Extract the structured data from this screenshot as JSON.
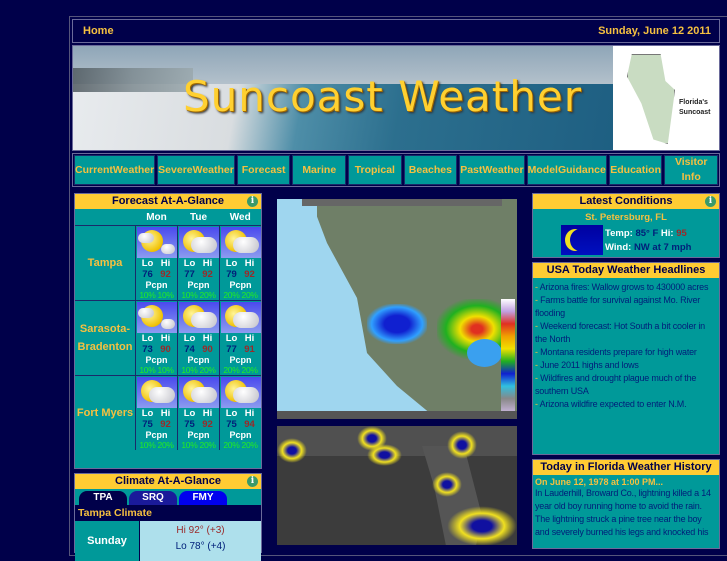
{
  "topbar": {
    "home": "Home",
    "date": "Sunday, June 12 2011"
  },
  "banner": {
    "title": "Suncoast Weather",
    "map_label_line1": "Florida's",
    "map_label_line2": "Suncoast"
  },
  "nav": [
    {
      "line1": "Current",
      "line2": "Weather"
    },
    {
      "line1": "Severe",
      "line2": "Weather"
    },
    {
      "line1": "Forecast",
      "line2": ""
    },
    {
      "line1": "Marine",
      "line2": ""
    },
    {
      "line1": "Tropical",
      "line2": ""
    },
    {
      "line1": "Beaches",
      "line2": ""
    },
    {
      "line1": "Past",
      "line2": "Weather"
    },
    {
      "line1": "Model",
      "line2": "Guidance"
    },
    {
      "line1": "Education",
      "line2": ""
    },
    {
      "line1": "Visitor Info",
      "line2": ""
    }
  ],
  "forecast": {
    "title": "Forecast At-A-Glance",
    "info_icon": "info-icon",
    "days": [
      "Mon",
      "Tue",
      "Wed"
    ],
    "labels": {
      "lo": "Lo",
      "hi": "Hi",
      "pcpn": "Pcpn"
    },
    "cities": [
      {
        "name_line1": "Tampa",
        "name_line2": "",
        "days": [
          {
            "icon": "partly-cloudy",
            "lo": "76",
            "hi": "92",
            "pcpn": "10% 10%"
          },
          {
            "icon": "mostly-cloudy",
            "lo": "77",
            "hi": "92",
            "pcpn": "10% 20%"
          },
          {
            "icon": "mostly-cloudy",
            "lo": "79",
            "hi": "92",
            "pcpn": "20% 20%"
          }
        ]
      },
      {
        "name_line1": "Sarasota-",
        "name_line2": "Bradenton",
        "days": [
          {
            "icon": "partly-cloudy",
            "lo": "73",
            "hi": "90",
            "pcpn": "10% 10%"
          },
          {
            "icon": "mostly-cloudy",
            "lo": "74",
            "hi": "90",
            "pcpn": "10% 20%"
          },
          {
            "icon": "mostly-cloudy",
            "lo": "77",
            "hi": "91",
            "pcpn": "20% 20%"
          }
        ]
      },
      {
        "name_line1": "Fort Myers",
        "name_line2": "",
        "days": [
          {
            "icon": "mostly-cloudy",
            "lo": "75",
            "hi": "92",
            "pcpn": "10% 20%"
          },
          {
            "icon": "mostly-cloudy",
            "lo": "75",
            "hi": "92",
            "pcpn": "10% 20%"
          },
          {
            "icon": "mostly-cloudy",
            "lo": "75",
            "hi": "94",
            "pcpn": "20% 20%"
          }
        ]
      }
    ]
  },
  "climate": {
    "title": "Climate At-A-Glance",
    "tabs": [
      "TPA",
      "SRQ",
      "FMY"
    ],
    "subtitle": "Tampa Climate",
    "day": "Sunday",
    "hi": "Hi 92° (+3)",
    "lo": "Lo 78° (+4)"
  },
  "latest": {
    "title": "Latest Conditions",
    "location": "St. Petersburg, FL",
    "temp_label": "Temp:",
    "temp_value": "85° F",
    "hi_label": "Hi:",
    "hi_value": "95",
    "wind_label": "Wind:",
    "wind_value": "NW at 7 mph",
    "icon": "moon-icon"
  },
  "headlines": {
    "title": "USA Today Weather Headlines",
    "items": [
      "Arizona fires: Wallow grows to 430000 acres",
      "Farms battle for survival against Mo. River flooding",
      "Weekend forecast: Hot South a bit cooler in the North",
      "Montana residents prepare for high water",
      "June 2011 highs and lows",
      "Wildfires and drought plague much of the southern USA",
      "Arizona wildfire expected to enter N.M."
    ]
  },
  "history": {
    "title": "Today in Florida Weather History",
    "when": "On June 12, 1978 at 1:00 PM...",
    "text": "In Lauderhill, Broward Co., lightning killed a 14 year old boy running home to avoid the rain. The lightning struck a pine tree near the boy and severely burned his legs and knocked his"
  }
}
